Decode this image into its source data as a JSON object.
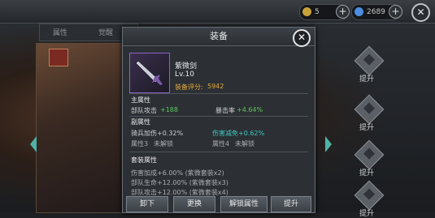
{
  "topbar": {
    "resource1": "5",
    "resource2": "2689",
    "plus1": "+",
    "plus2": "+",
    "close": "✕"
  },
  "background": {
    "tabs": [
      "属性",
      "觉醒"
    ],
    "slots": [
      {
        "label": "提升"
      },
      {
        "label": "提升"
      },
      {
        "label": "提升"
      },
      {
        "label": "提升"
      }
    ]
  },
  "panel": {
    "title": "装备",
    "close": "✕",
    "item": {
      "name": "紫微剑",
      "level": "Lv.10",
      "score_label": "装备评分:",
      "score_value": "5942"
    },
    "main_attr": {
      "header": "主属性",
      "attr1_label": "部队攻击",
      "attr1_value": "+188",
      "attr2_label": "暴击率",
      "attr2_value": "+4.64%"
    },
    "sub_attr": {
      "header": "副属性",
      "attr1": "骑兵加伤+0.32%",
      "attr2": "伤害减免+0.62%",
      "attr3_label": "属性3",
      "attr3_status": "未解锁",
      "attr4_label": "属性4",
      "attr4_status": "未解锁"
    },
    "set_attr": {
      "header": "套装属性",
      "line1": "伤害加成+6.00% (紫微套装x2)",
      "line2": "部队生命+12.00% (紫微套装x3)",
      "line3": "部队攻击+12.00% (紫微套装x4)"
    },
    "buttons": [
      "卸下",
      "更换",
      "解锁属性",
      "提升"
    ]
  },
  "colors": {
    "green": "#5ec85a",
    "orange": "#e0a83c",
    "cyan": "#3ec7c0",
    "purple_border": "#8c62c4"
  }
}
